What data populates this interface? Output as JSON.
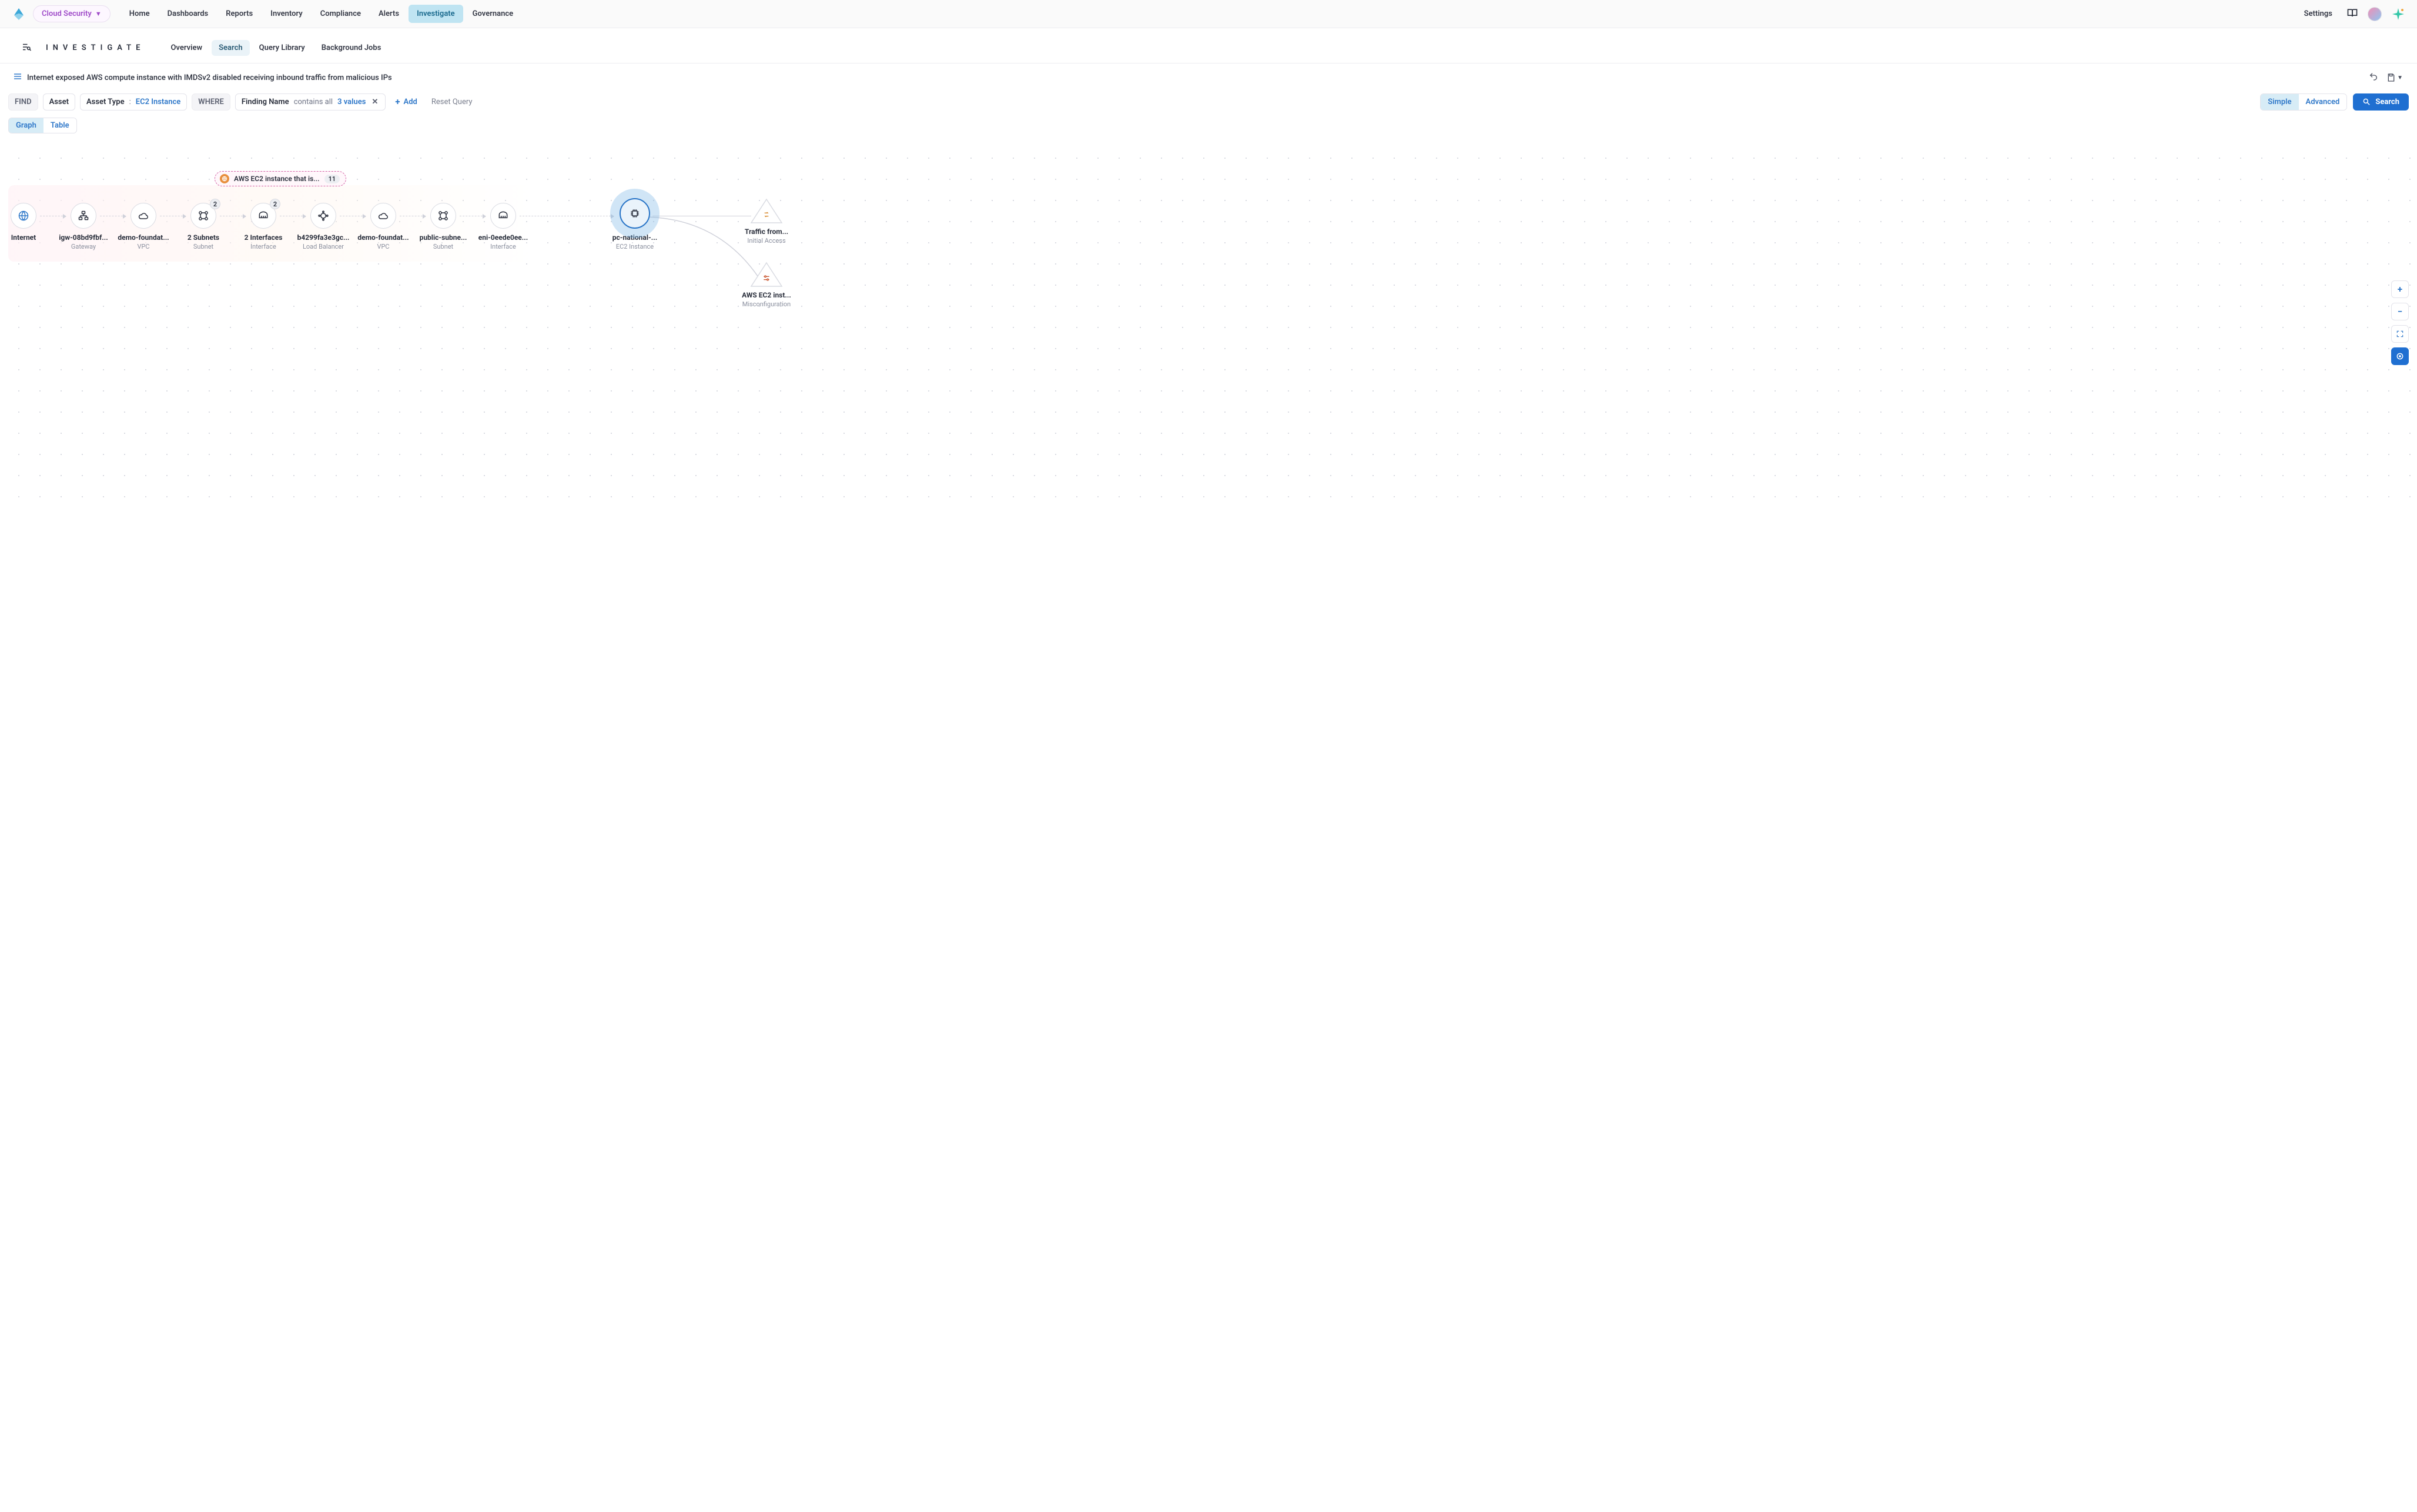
{
  "product": {
    "name": "Cloud Security"
  },
  "nav": {
    "items": [
      {
        "label": "Home"
      },
      {
        "label": "Dashboards"
      },
      {
        "label": "Reports"
      },
      {
        "label": "Inventory"
      },
      {
        "label": "Compliance"
      },
      {
        "label": "Alerts"
      },
      {
        "label": "Investigate"
      },
      {
        "label": "Governance"
      }
    ],
    "settings_label": "Settings"
  },
  "subheader": {
    "title": "INVESTIGATE",
    "tabs": [
      {
        "label": "Overview"
      },
      {
        "label": "Search"
      },
      {
        "label": "Query Library"
      },
      {
        "label": "Background Jobs"
      }
    ]
  },
  "query": {
    "title": "Internet exposed AWS compute instance with IMDSv2 disabled receiving inbound traffic from malicious IPs",
    "find_label": "FIND",
    "asset_label": "Asset",
    "asset_type_label": "Asset Type",
    "asset_type_value": "EC2 Instance",
    "where_label": "WHERE",
    "finding_name_label": "Finding Name",
    "finding_op": "contains all",
    "finding_values": "3 values",
    "add_label": "Add",
    "reset_label": "Reset Query",
    "simple_label": "Simple",
    "advanced_label": "Advanced",
    "search_label": "Search",
    "graph_label": "Graph",
    "table_label": "Table"
  },
  "graph": {
    "badge": {
      "label": "AWS EC2 instance that is...",
      "count": "11"
    },
    "nodes": [
      {
        "label": "Internet",
        "type": ""
      },
      {
        "label": "igw-08bd9fbf...",
        "type": "Gateway"
      },
      {
        "label": "demo-foundat...",
        "type": "VPC"
      },
      {
        "label": "2 Subnets",
        "type": "Subnet",
        "count": "2"
      },
      {
        "label": "2 Interfaces",
        "type": "Interface",
        "count": "2"
      },
      {
        "label": "b4299fa3e3gc...",
        "type": "Load Balancer"
      },
      {
        "label": "demo-foundat...",
        "type": "VPC"
      },
      {
        "label": "public-subne...",
        "type": "Subnet"
      },
      {
        "label": "eni-0eede0ee...",
        "type": "Interface"
      },
      {
        "label": "pc-national-...",
        "type": "EC2 Instance"
      },
      {
        "label": "Traffic from...",
        "type": "Initial Access"
      },
      {
        "label": "AWS EC2 inst...",
        "type": "Misconfiguration"
      }
    ]
  }
}
